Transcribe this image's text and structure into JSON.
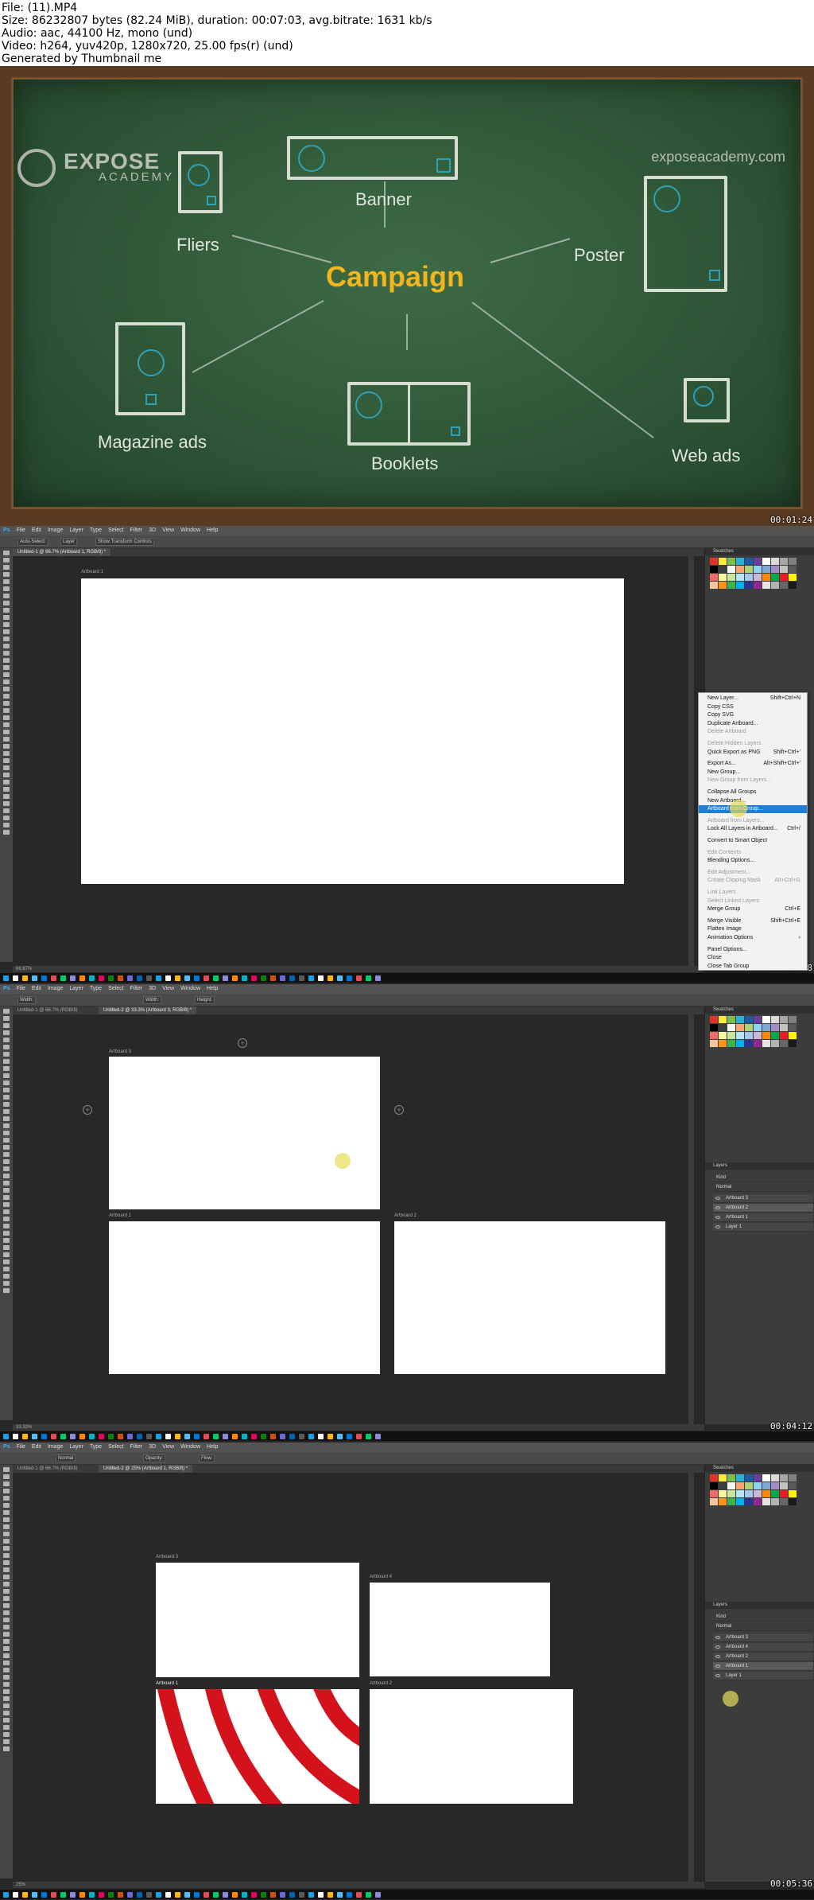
{
  "header": {
    "line1": "File:  (11).MP4",
    "line2": "Size: 86232807 bytes (82.24 MiB), duration: 00:07:03, avg.bitrate: 1631 kb/s",
    "line3": "Audio: aac, 44100 Hz, mono (und)",
    "line4": "Video: h264, yuv420p, 1280x720, 25.00 fps(r) (und)",
    "line5": "Generated by Thumbnail me"
  },
  "frame1": {
    "logo_top": "EXPOSE",
    "logo_bottom": "ACADEMY",
    "website": "exposeacademy.com",
    "center": "Campaign",
    "labels": {
      "fliers": "Fliers",
      "banner": "Banner",
      "poster": "Poster",
      "magazine": "Magazine ads",
      "booklets": "Booklets",
      "webads": "Web ads"
    },
    "timestamp": "00:01:24"
  },
  "ps": {
    "menu": [
      "Ps",
      "File",
      "Edit",
      "Image",
      "Layer",
      "Type",
      "Select",
      "Filter",
      "3D",
      "View",
      "Window",
      "Help"
    ],
    "frame2": {
      "opt1": "Auto-Select:",
      "opt2": "Layer",
      "opt3": "Show Transform Controls",
      "tab1": "Untitled-1 @ 66.7% (Artboard 1, RGB/8) *",
      "ab1": "Artboard 1",
      "status": "66.67%",
      "timestamp": "00:02:48",
      "panel_title": "Swatches"
    },
    "context_menu": [
      {
        "label": "New Layer...",
        "sc": "Shift+Ctrl+N",
        "state": "normal"
      },
      {
        "label": "Copy CSS",
        "sc": "",
        "state": "normal"
      },
      {
        "label": "Copy SVG",
        "sc": "",
        "state": "normal"
      },
      {
        "label": "Duplicate Artboard...",
        "sc": "",
        "state": "normal"
      },
      {
        "label": "Delete Artboard",
        "sc": "",
        "state": "dis"
      },
      {
        "label": "Delete Hidden Layers",
        "sc": "",
        "state": "dis"
      },
      {
        "label": "Quick Export as PNG",
        "sc": "Shift+Ctrl+'",
        "state": "normal"
      },
      {
        "label": "Export As...",
        "sc": "Alt+Shift+Ctrl+'",
        "state": "normal"
      },
      {
        "label": "New Group...",
        "sc": "",
        "state": "normal"
      },
      {
        "label": "New Group from Layers...",
        "sc": "",
        "state": "dis"
      },
      {
        "label": "Collapse All Groups",
        "sc": "",
        "state": "normal"
      },
      {
        "label": "New Artboard...",
        "sc": "",
        "state": "normal"
      },
      {
        "label": "Artboard from Group...",
        "sc": "",
        "state": "hl"
      },
      {
        "label": "Artboard from Layers...",
        "sc": "",
        "state": "dis"
      },
      {
        "label": "Lock All Layers in Artboard...",
        "sc": "Ctrl+/",
        "state": "normal"
      },
      {
        "label": "Convert to Smart Object",
        "sc": "",
        "state": "normal"
      },
      {
        "label": "Edit Contents",
        "sc": "",
        "state": "dis"
      },
      {
        "label": "Blending Options...",
        "sc": "",
        "state": "normal"
      },
      {
        "label": "Edit Adjustment...",
        "sc": "",
        "state": "dis"
      },
      {
        "label": "Create Clipping Mask",
        "sc": "Alt+Ctrl+G",
        "state": "dis"
      },
      {
        "label": "Link Layers",
        "sc": "",
        "state": "dis"
      },
      {
        "label": "Select Linked Layers",
        "sc": "",
        "state": "dis"
      },
      {
        "label": "Merge Group",
        "sc": "Ctrl+E",
        "state": "normal"
      },
      {
        "label": "Merge Visible",
        "sc": "Shift+Ctrl+E",
        "state": "normal"
      },
      {
        "label": "Flatten Image",
        "sc": "",
        "state": "normal"
      },
      {
        "label": "Animation Options",
        "sc": "›",
        "state": "normal"
      },
      {
        "label": "Panel Options...",
        "sc": "",
        "state": "normal"
      },
      {
        "label": "Close",
        "sc": "",
        "state": "normal"
      },
      {
        "label": "Close Tab Group",
        "sc": "",
        "state": "normal"
      }
    ],
    "frame3": {
      "opt_w": "Width:",
      "opt_h": "Height:",
      "tab1": "Untitled-1 @ 66.7% (RGB/8)",
      "tab2": "Untitled-2 @ 33.3% (Artboard 3, RGB/8) *",
      "ab3": "Artboard 3",
      "ab1": "Artboard 1",
      "ab2": "Artboard 2",
      "status": "33.33%",
      "timestamp": "00:04:12",
      "layers": [
        "Artboard 3",
        "Artboard 2",
        "Artboard 1",
        "Layer 1"
      ]
    },
    "frame4": {
      "opt_mode": "Mode:",
      "opt_mode_val": "Normal",
      "opt_op": "Opacity:",
      "opt_flow": "Flow:",
      "tab1": "Untitled-1 @ 66.7% (RGB/8)",
      "tab2": "Untitled-2 @ 25% (Artboard 1, RGB/8) *",
      "ab3": "Artboard 3",
      "ab4": "Artboard 4",
      "ab1": "Artboard 1",
      "ab2": "Artboard 2",
      "status": "25%",
      "timestamp": "00:05:36",
      "layers": [
        "Artboard 3",
        "Artboard 4",
        "Artboard 2",
        "Artboard 1",
        "Layer 1"
      ]
    },
    "panel_tabs": {
      "layers": "Layers",
      "channels": "Channels",
      "paths": "Paths"
    },
    "blend_mode": "Normal",
    "kind": "Kind",
    "swatch_colors": [
      "#e8312a",
      "#f7ec3f",
      "#7ac143",
      "#2bb0d6",
      "#1d5ba8",
      "#6a3d98",
      "#ffffff",
      "#d9d9d9",
      "#a6a6a6",
      "#7f7f7f",
      "#000000",
      "#3e3e3e",
      "#f5f5f5",
      "#f9a26c",
      "#a7d672",
      "#8fd3f0",
      "#7da7d9",
      "#a68cc6",
      "#c2c2c2",
      "#595959",
      "#f26b6b",
      "#fcf6a0",
      "#c7e79e",
      "#b3e3f4",
      "#a9c5e9",
      "#c9b7de",
      "#ff8a00",
      "#00a651",
      "#ed1c24",
      "#fff200",
      "#f3c89b",
      "#f7941d",
      "#39b54a",
      "#00aeef",
      "#2e3192",
      "#92278f",
      "#e6e6e6",
      "#b3b3b3",
      "#666666",
      "#1a1a1a"
    ],
    "taskbar_colors": [
      "#1ba1e2",
      "#ffffff",
      "#ffb900",
      "#4cc2ff",
      "#0078d7",
      "#e74856",
      "#00cc6a",
      "#8e8cd8",
      "#ff8c00",
      "#00b7c3",
      "#ea005e",
      "#107c10",
      "#ca5010",
      "#6b69d6",
      "#0063b1",
      "#5d5a58"
    ]
  }
}
